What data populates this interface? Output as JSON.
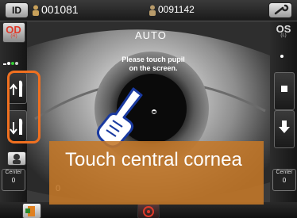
{
  "topbar": {
    "id_label": "ID",
    "patient_id": "001081",
    "operator_id": "0091142"
  },
  "left_panel": {
    "eye": "OD",
    "eye_sub": "(R)",
    "center_label": "Center",
    "center_value": "0"
  },
  "right_panel": {
    "eye": "OS",
    "eye_sub": "(L)",
    "center_label": "Center",
    "center_value": "0"
  },
  "camera": {
    "mode": "AUTO",
    "instruction_line1": "Please touch pupil",
    "instruction_line2": "on the screen.",
    "bottom_left_value": "0"
  },
  "caption": {
    "text": "Touch central cornea"
  },
  "colors": {
    "highlight": "#f07020",
    "caption_bg": "#c47828",
    "od_red": "#e03a2a"
  }
}
